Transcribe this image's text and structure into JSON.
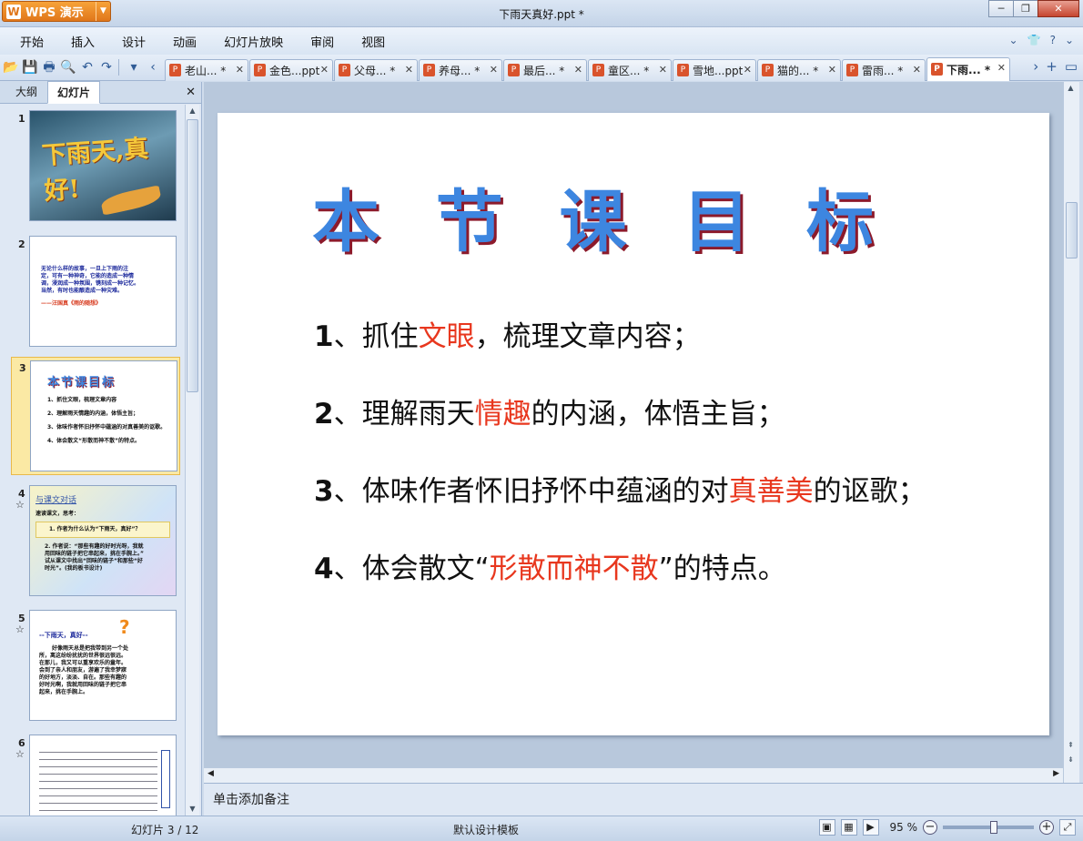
{
  "window": {
    "app_button": "WPS 演示",
    "title": "下雨天真好.ppt *"
  },
  "menu": [
    "开始",
    "插入",
    "设计",
    "动画",
    "幻灯片放映",
    "审阅",
    "视图"
  ],
  "doc_tabs": [
    {
      "label": "老山... *"
    },
    {
      "label": "金色...ppt"
    },
    {
      "label": "父母... *"
    },
    {
      "label": "养母... *"
    },
    {
      "label": "最后... *"
    },
    {
      "label": "童区... *"
    },
    {
      "label": "雪地...ppt"
    },
    {
      "label": "猫的... *"
    },
    {
      "label": "雷雨... *"
    },
    {
      "label": "下雨... *"
    }
  ],
  "left_panel": {
    "tab_outline": "大纲",
    "tab_slides": "幻灯片",
    "thumbnails": [
      {
        "num": "1",
        "title": "下雨天,真好!"
      },
      {
        "num": "2",
        "lines": [
          "无论什么样的故事，一旦上下雨的注",
          "定，可有一种神奇，它能的造成一种情",
          "调，浸润成一种氛围，镌刻成一种记忆。",
          "当然，有时也能酿造成一种灾难。"
        ],
        "quote": "——汪国真《雨的随想》"
      },
      {
        "num": "3",
        "title": "本节课目标",
        "lines": [
          "1、抓住文眼，梳理文章内容",
          "2、理解雨天情趣的内涵，体悟主旨；",
          "3、体味作者怀旧抒怀中蕴涵的对真善美的讴歌。",
          "4、体会散文“形散而神不散”的特点。"
        ]
      },
      {
        "num": "4",
        "heading": "与课文对话",
        "lines": [
          "速读课文，思考：",
          "1. 作者为什么认为“下雨天，真好”？",
          "2. 作者说：“那些有趣的好时光呀，我就",
          "用回味的链子把它串起来，挑在手腕上。”",
          "试从课文中找出“回味的链子”和那些“好",
          "时光”。(我的板书设计)"
        ]
      },
      {
        "num": "5",
        "heading": "--下雨天，真好--",
        "lines": [
          "好像雨天总是把我带到另一个处",
          "所，离这纷纷扰扰的世界很远很远。",
          "在那儿，我又可以重享欢乐的童年。",
          "会到了亲人和朋友，游遍了我幸梦寐",
          "的好地方，淡淡、自在。那些有趣的",
          "好时光啊，我就用回味的链子把它串",
          "起来，挑在手腕上。"
        ]
      },
      {
        "num": "6"
      }
    ]
  },
  "slide": {
    "title": "本 节 课 目 标",
    "goals": [
      {
        "num": "1",
        "pre": "、抓住",
        "hl": "文眼",
        "post": "，梳理文章内容；"
      },
      {
        "num": "2",
        "pre": "、理解雨天",
        "hl": "情趣",
        "post": "的内涵，体悟主旨；"
      },
      {
        "num": "3",
        "pre": "、体味作者怀旧抒怀中蕴涵的对",
        "hl": "真善美",
        "post": "的讴歌；"
      },
      {
        "num": "4",
        "pre": "、体会散文“",
        "hl": "形散而神不散",
        "post": "”的特点。"
      }
    ]
  },
  "notes_placeholder": "单击添加备注",
  "status": {
    "slide_counter": "幻灯片 3 / 12",
    "template": "默认设计模板",
    "zoom": "95 %"
  },
  "colors": {
    "highlight": "#e8371e",
    "title_blue": "#3d86e0"
  }
}
